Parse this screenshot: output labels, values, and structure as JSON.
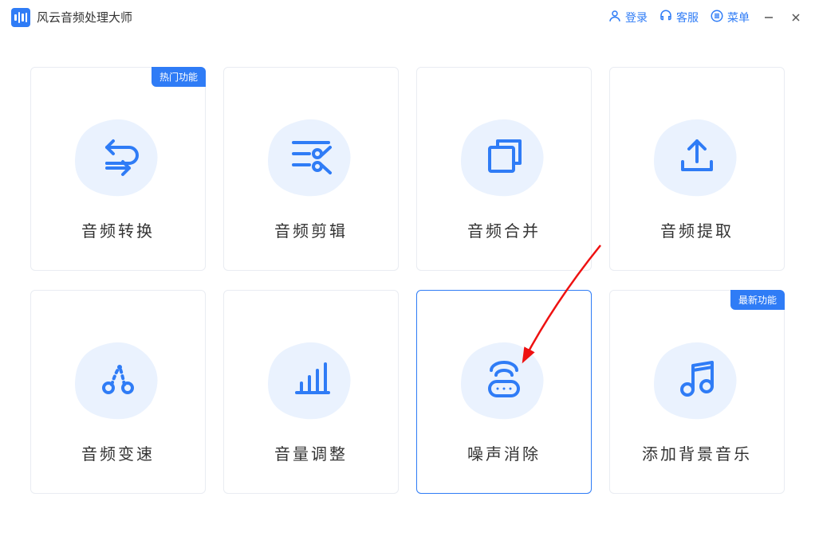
{
  "app": {
    "title": "风云音频处理大师"
  },
  "titlebar": {
    "login": "登录",
    "support": "客服",
    "menu": "菜单"
  },
  "badges": {
    "hot": "热门功能",
    "new": "最新功能"
  },
  "cards": [
    {
      "label": "音频转换",
      "icon": "convert-icon",
      "badge": "hot"
    },
    {
      "label": "音频剪辑",
      "icon": "cut-icon"
    },
    {
      "label": "音频合并",
      "icon": "merge-icon"
    },
    {
      "label": "音频提取",
      "icon": "extract-icon"
    },
    {
      "label": "音频变速",
      "icon": "speed-icon"
    },
    {
      "label": "音量调整",
      "icon": "volume-icon"
    },
    {
      "label": "噪声消除",
      "icon": "denoise-icon",
      "selected": true
    },
    {
      "label": "添加背景音乐",
      "icon": "bgmusic-icon",
      "badge": "new"
    }
  ],
  "colors": {
    "accent": "#2f7cf6",
    "blob": "#eaf2fe",
    "iconStroke": "#2f7cf6"
  }
}
